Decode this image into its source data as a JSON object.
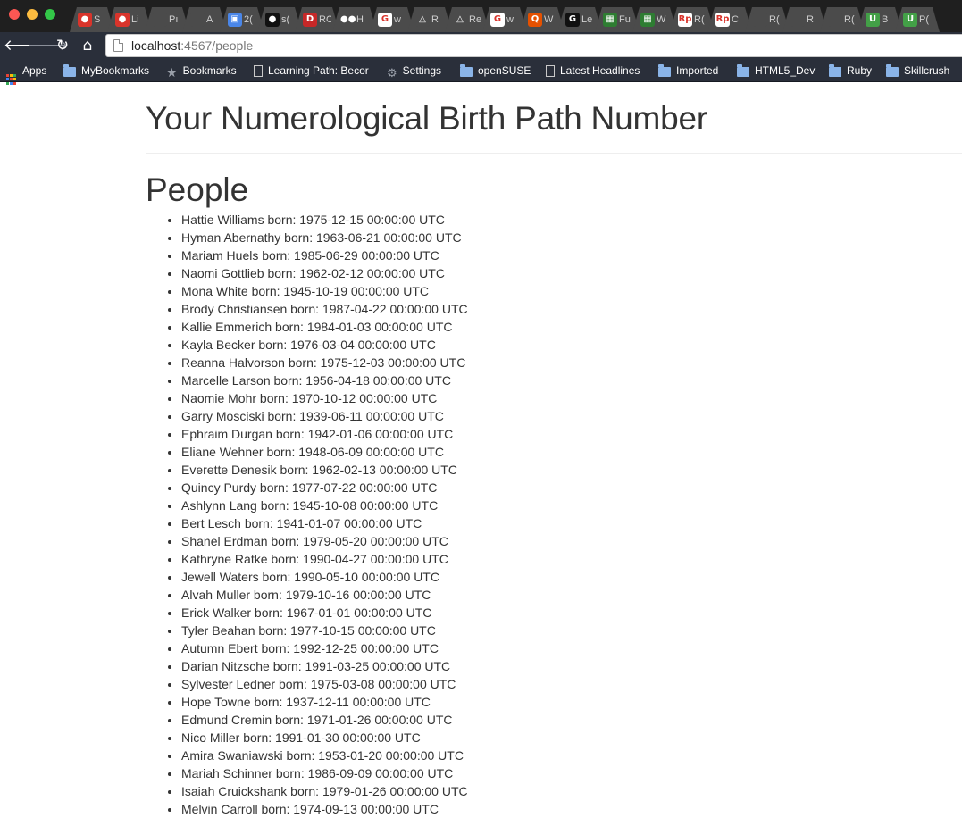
{
  "browser": {
    "tabs": [
      {
        "favicon_color": "#d9342b",
        "favicon_glyph": "●",
        "label": "S"
      },
      {
        "favicon_color": "#d9342b",
        "favicon_glyph": "●",
        "label": "Li"
      },
      {
        "favicon_color": "#4b4b4b",
        "favicon_glyph": "",
        "label": "Pı"
      },
      {
        "favicon_color": "#4b4b4b",
        "favicon_glyph": "",
        "label": "A"
      },
      {
        "favicon_color": "#4a86e8",
        "favicon_glyph": "▣",
        "label": "2("
      },
      {
        "favicon_color": "#111111",
        "favicon_glyph": "●",
        "label": "s("
      },
      {
        "favicon_color": "#c62828",
        "favicon_glyph": "D",
        "label": "RO"
      },
      {
        "favicon_color": "#4b4b4b",
        "favicon_glyph": "●●",
        "label": "H"
      },
      {
        "favicon_color": "#ffffff",
        "favicon_glyph": "G",
        "label": "w"
      },
      {
        "favicon_color": "#4b4b4b",
        "favicon_glyph": "△",
        "label": "R"
      },
      {
        "favicon_color": "#4b4b4b",
        "favicon_glyph": "△",
        "label": "Re"
      },
      {
        "favicon_color": "#ffffff",
        "favicon_glyph": "G",
        "label": "w"
      },
      {
        "favicon_color": "#e65100",
        "favicon_glyph": "Q",
        "label": "W"
      },
      {
        "favicon_color": "#111111",
        "favicon_glyph": "G",
        "label": "Le"
      },
      {
        "favicon_color": "#2e7d32",
        "favicon_glyph": "▦",
        "label": "Fu"
      },
      {
        "favicon_color": "#2e7d32",
        "favicon_glyph": "▦",
        "label": "W"
      },
      {
        "favicon_color": "#ffffff",
        "favicon_glyph": "Rp",
        "label": "R("
      },
      {
        "favicon_color": "#ffffff",
        "favicon_glyph": "Rp",
        "label": "C"
      },
      {
        "favicon_color": "#4b4b4b",
        "favicon_glyph": "",
        "label": "R("
      },
      {
        "favicon_color": "#4b4b4b",
        "favicon_glyph": "",
        "label": "R"
      },
      {
        "favicon_color": "#4b4b4b",
        "favicon_glyph": "",
        "label": "R("
      },
      {
        "favicon_color": "#43a047",
        "favicon_glyph": "U",
        "label": "B"
      },
      {
        "favicon_color": "#43a047",
        "favicon_glyph": "U",
        "label": "P("
      }
    ],
    "url_host": "localhost",
    "url_rest": ":4567/people",
    "bookmarks": [
      {
        "icon": "apps-grid",
        "label": "Apps"
      },
      {
        "icon": "folder",
        "label": "MyBookmarks"
      },
      {
        "icon": "star",
        "label": "Bookmarks"
      },
      {
        "icon": "page",
        "label": "Learning Path: Becor"
      },
      {
        "icon": "gear",
        "label": "Settings"
      },
      {
        "icon": "folder",
        "label": "openSUSE"
      },
      {
        "icon": "page",
        "label": "Latest Headlines"
      },
      {
        "icon": "folder",
        "label": "Imported"
      },
      {
        "icon": "folder",
        "label": "HTML5_Dev"
      },
      {
        "icon": "folder",
        "label": "Ruby"
      },
      {
        "icon": "folder",
        "label": "Skillcrush"
      }
    ]
  },
  "page": {
    "title": "Your Numerological Birth Path Number",
    "section_heading": "People",
    "people": [
      "Hattie Williams born: 1975-12-15 00:00:00 UTC",
      "Hyman Abernathy born: 1963-06-21 00:00:00 UTC",
      "Mariam Huels born: 1985-06-29 00:00:00 UTC",
      "Naomi Gottlieb born: 1962-02-12 00:00:00 UTC",
      "Mona White born: 1945-10-19 00:00:00 UTC",
      "Brody Christiansen born: 1987-04-22 00:00:00 UTC",
      "Kallie Emmerich born: 1984-01-03 00:00:00 UTC",
      "Kayla Becker born: 1976-03-04 00:00:00 UTC",
      "Reanna Halvorson born: 1975-12-03 00:00:00 UTC",
      "Marcelle Larson born: 1956-04-18 00:00:00 UTC",
      "Naomie Mohr born: 1970-10-12 00:00:00 UTC",
      "Garry Mosciski born: 1939-06-11 00:00:00 UTC",
      "Ephraim Durgan born: 1942-01-06 00:00:00 UTC",
      "Eliane Wehner born: 1948-06-09 00:00:00 UTC",
      "Everette Denesik born: 1962-02-13 00:00:00 UTC",
      "Quincy Purdy born: 1977-07-22 00:00:00 UTC",
      "Ashlynn Lang born: 1945-10-08 00:00:00 UTC",
      "Bert Lesch born: 1941-01-07 00:00:00 UTC",
      "Shanel Erdman born: 1979-05-20 00:00:00 UTC",
      "Kathryne Ratke born: 1990-04-27 00:00:00 UTC",
      "Jewell Waters born: 1990-05-10 00:00:00 UTC",
      "Alvah Muller born: 1979-10-16 00:00:00 UTC",
      "Erick Walker born: 1967-01-01 00:00:00 UTC",
      "Tyler Beahan born: 1977-10-15 00:00:00 UTC",
      "Autumn Ebert born: 1992-12-25 00:00:00 UTC",
      "Darian Nitzsche born: 1991-03-25 00:00:00 UTC",
      "Sylvester Ledner born: 1975-03-08 00:00:00 UTC",
      "Hope Towne born: 1937-12-11 00:00:00 UTC",
      "Edmund Cremin born: 1971-01-26 00:00:00 UTC",
      "Nico Miller born: 1991-01-30 00:00:00 UTC",
      "Amira Swaniawski born: 1953-01-20 00:00:00 UTC",
      "Mariah Schinner born: 1986-09-09 00:00:00 UTC",
      "Isaiah Cruickshank born: 1979-01-26 00:00:00 UTC",
      "Melvin Carroll born: 1974-09-13 00:00:00 UTC"
    ]
  }
}
